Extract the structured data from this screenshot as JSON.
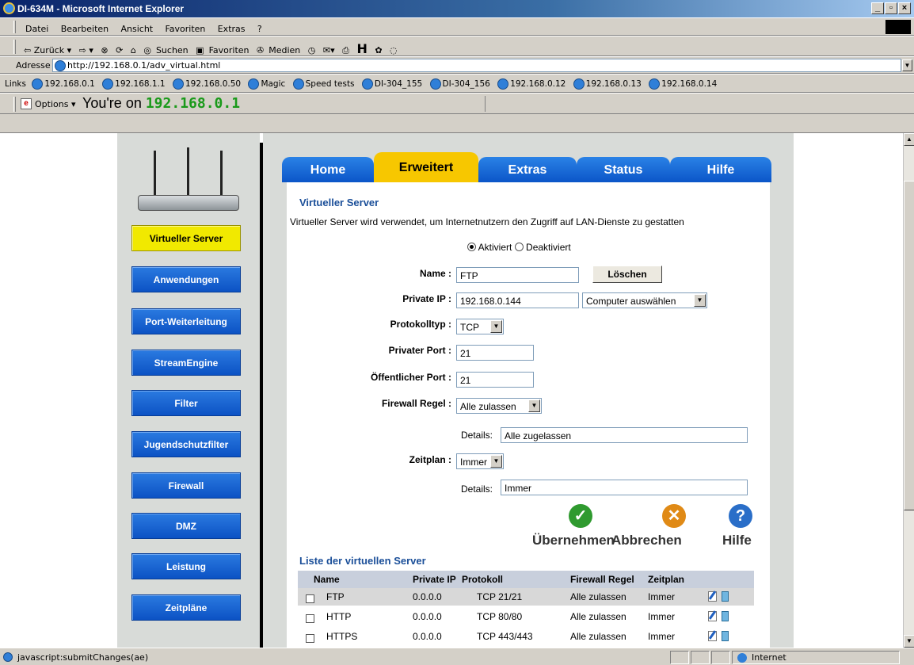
{
  "window": {
    "title": "DI-634M - Microsoft Internet Explorer"
  },
  "menu": [
    "Datei",
    "Bearbeiten",
    "Ansicht",
    "Favoriten",
    "Extras",
    "?"
  ],
  "toolbar": {
    "back": "⇦ Zurück ▾",
    "forward": "⇨ ▾",
    "search": "Suchen",
    "favorites": "Favoriten",
    "media": "Medien"
  },
  "address": {
    "label": "Adresse",
    "url": "http://192.168.0.1/adv_virtual.html"
  },
  "links": {
    "label": "Links",
    "items": [
      "192.168.0.1",
      "192.168.1.1",
      "192.168.0.50",
      "Magic",
      "Speed tests",
      "DI-304_155",
      "DI-304_156",
      "192.168.0.12",
      "192.168.0.13",
      "192.168.0.14"
    ]
  },
  "options": {
    "label": "Options ▾",
    "prefix": "You're on ",
    "host": "192.168.0.1"
  },
  "sidebar": {
    "items": [
      "Virtueller Server",
      "Anwendungen",
      "Port-Weiterleitung",
      "StreamEngine",
      "Filter",
      "Jugendschutzfilter",
      "Firewall",
      "DMZ",
      "Leistung",
      "Zeitpläne"
    ],
    "active": "Virtueller Server"
  },
  "tabs": [
    "Home",
    "Erweitert",
    "Extras",
    "Status",
    "Hilfe"
  ],
  "form": {
    "title": "Virtueller Server",
    "description": "Virtueller Server wird verwendet, um Internetnutzern den Zugriff auf LAN-Dienste zu gestatten",
    "enabled_label": "Aktiviert",
    "disabled_label": "Deaktiviert",
    "name_label": "Name :",
    "name_value": "FTP",
    "delete_button": "Löschen",
    "private_ip_label": "Private IP :",
    "private_ip_value": "192.168.0.144",
    "computer_select": "Computer auswählen",
    "protocol_label": "Protokolltyp :",
    "protocol_value": "TCP",
    "private_port_label": "Privater Port :",
    "private_port_value": "21",
    "public_port_label": "Öffentlicher Port :",
    "public_port_value": "21",
    "firewall_label": "Firewall Regel :",
    "firewall_value": "Alle zulassen",
    "details_label": "Details:",
    "firewall_details": "Alle zugelassen",
    "schedule_label": "Zeitplan :",
    "schedule_value": "Immer",
    "schedule_details": "Immer"
  },
  "actions": {
    "apply": "Übernehmen",
    "cancel": "Abbrechen",
    "help": "Hilfe",
    "apply_icon": "checkmark-icon",
    "cancel_icon": "x-icon",
    "help_icon": "question-icon"
  },
  "list": {
    "title": "Liste der virtuellen Server",
    "columns": [
      "Name",
      "Private IP",
      "Protokoll",
      "Firewall Regel",
      "Zeitplan"
    ],
    "rows": [
      {
        "name": "FTP",
        "ip": "0.0.0.0",
        "proto": "TCP 21/21",
        "fw": "Alle zulassen",
        "sched": "Immer"
      },
      {
        "name": "HTTP",
        "ip": "0.0.0.0",
        "proto": "TCP 80/80",
        "fw": "Alle zulassen",
        "sched": "Immer"
      },
      {
        "name": "HTTPS",
        "ip": "0.0.0.0",
        "proto": "TCP 443/443",
        "fw": "Alle zulassen",
        "sched": "Immer"
      }
    ]
  },
  "status": {
    "text": "javascript:submitChanges(ae)",
    "zone": "Internet"
  },
  "colors": {
    "nav_blue": "#0c52c4",
    "active_yellow": "#f1e900",
    "tab_active": "#f7c700",
    "heading_blue": "#1b4f99"
  }
}
